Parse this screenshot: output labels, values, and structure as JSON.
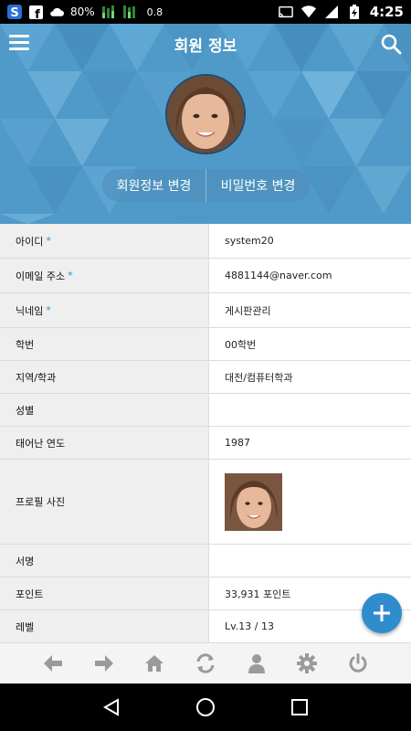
{
  "status_bar": {
    "battery_percent": "80%",
    "speed": "0.8",
    "time": "4:25",
    "icons": [
      "s-app-icon",
      "facebook-icon",
      "cloud-icon",
      "battery-icon",
      "equalizer-icon",
      "equalizer-icon",
      "cast-icon",
      "wifi-icon",
      "signal-icon",
      "battery-charging-icon"
    ]
  },
  "header": {
    "title": "회원 정보",
    "menu_icon": "hamburger-menu-icon",
    "search_icon": "search-icon",
    "edit_profile_label": "회원정보 변경",
    "change_password_label": "비밀번호 변경"
  },
  "fields": [
    {
      "label": "아이디",
      "required": "*",
      "value": "system20"
    },
    {
      "label": "이메일 주소",
      "required": "*",
      "value": "4881144@naver.com"
    },
    {
      "label": "닉네임",
      "required": "*",
      "value": "게시판관리"
    },
    {
      "label": "학번",
      "required": "",
      "value": "00학번"
    },
    {
      "label": "지역/학과",
      "required": "",
      "value": "대전/컴퓨터학과"
    },
    {
      "label": "성별",
      "required": "",
      "value": ""
    },
    {
      "label": "태어난 연도",
      "required": "",
      "value": "1987"
    },
    {
      "label": "프로필 사진",
      "required": "",
      "value": ""
    },
    {
      "label": "서명",
      "required": "",
      "value": ""
    },
    {
      "label": "포인트",
      "required": "",
      "value": "33,931 포인트"
    },
    {
      "label": "레벨",
      "required": "",
      "value": "Lv.13 / 13"
    }
  ],
  "toolbar": {
    "icons": [
      "back-arrow-icon",
      "forward-arrow-icon",
      "home-icon",
      "refresh-icon",
      "user-icon",
      "settings-gear-icon",
      "power-icon"
    ]
  },
  "fab": {
    "icon": "plus-icon"
  },
  "colors": {
    "accent": "#2f8ccd",
    "header_bg": "#4f9ac8",
    "required_mark": "#2a8fd0"
  }
}
